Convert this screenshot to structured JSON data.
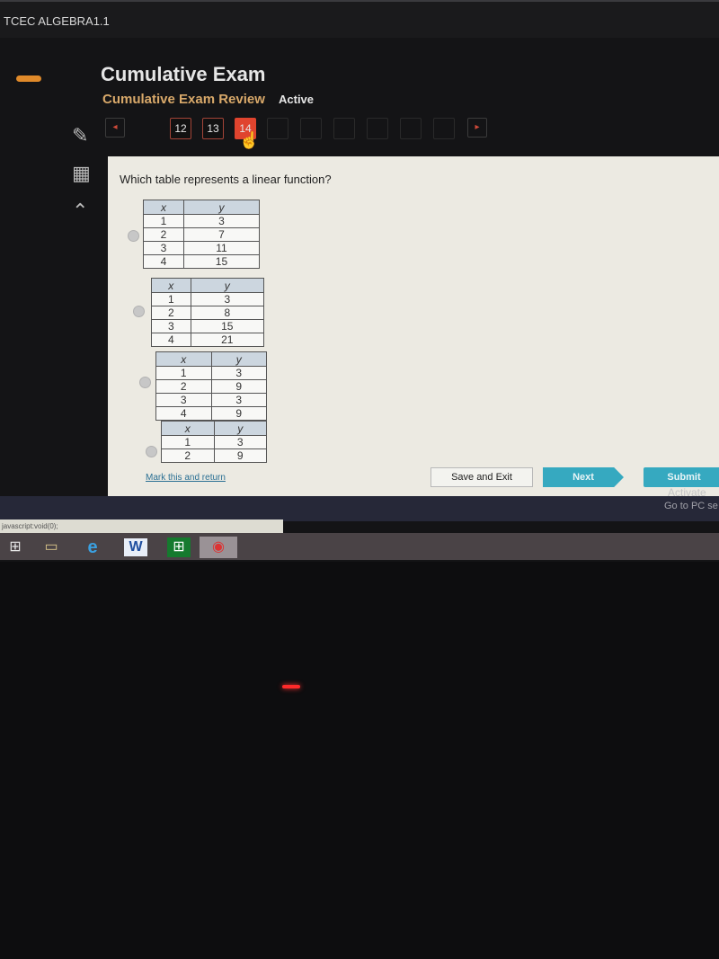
{
  "header": {
    "course_title": "TCEC ALGEBRA1.1",
    "title": "Cumulative Exam",
    "subtitle": "Cumulative Exam Review",
    "status": "Active"
  },
  "pagination": {
    "prev_icon": "◂",
    "next_icon": "▸",
    "questions": [
      "12",
      "13",
      "14"
    ],
    "current": "14"
  },
  "tools": {
    "pencil_icon": "✎",
    "calculator_icon": "▦",
    "collapse_icon": "⌃"
  },
  "question": {
    "text": "Which table represents a linear function?",
    "options": [
      {
        "headers": [
          "x",
          "y"
        ],
        "rows": [
          [
            "1",
            "3"
          ],
          [
            "2",
            "7"
          ],
          [
            "3",
            "11"
          ],
          [
            "4",
            "15"
          ]
        ]
      },
      {
        "headers": [
          "x",
          "y"
        ],
        "rows": [
          [
            "1",
            "3"
          ],
          [
            "2",
            "8"
          ],
          [
            "3",
            "15"
          ],
          [
            "4",
            "21"
          ]
        ]
      },
      {
        "headers": [
          "x",
          "y"
        ],
        "rows": [
          [
            "1",
            "3"
          ],
          [
            "2",
            "9"
          ],
          [
            "3",
            "3"
          ],
          [
            "4",
            "9"
          ]
        ]
      },
      {
        "headers": [
          "x",
          "y"
        ],
        "rows": [
          [
            "1",
            "3"
          ],
          [
            "2",
            "9"
          ]
        ]
      }
    ]
  },
  "footer": {
    "mark_label": "Mark this and return",
    "save_label": "Save and Exit",
    "next_label": "Next",
    "submit_label": "Submit"
  },
  "watermark": {
    "line1": "Activate",
    "line2": "Go to PC se"
  },
  "browser": {
    "status_url": "javascript:void(0);"
  },
  "taskbar": {
    "start_icon": "⊞",
    "explorer_icon": "▭",
    "ie_icon": "e",
    "word_icon": "W",
    "store_icon": "⊞",
    "chrome_icon": "◉"
  }
}
